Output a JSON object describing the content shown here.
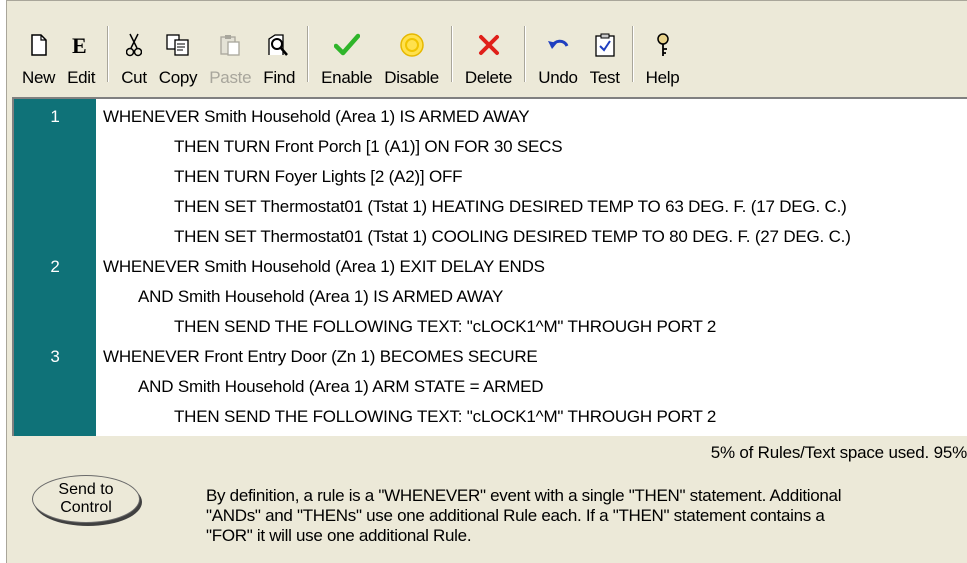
{
  "toolbar": {
    "buttons": [
      {
        "label": "New",
        "icon": "new-document-icon"
      },
      {
        "label": "Edit",
        "icon": "edit-icon"
      },
      {
        "label": "Cut",
        "icon": "scissors-icon"
      },
      {
        "label": "Copy",
        "icon": "copy-icon"
      },
      {
        "label": "Paste",
        "icon": "paste-icon",
        "disabled": true
      },
      {
        "label": "Find",
        "icon": "find-icon"
      },
      {
        "label": "Enable",
        "icon": "checkmark-icon"
      },
      {
        "label": "Disable",
        "icon": "disable-icon"
      },
      {
        "label": "Delete",
        "icon": "delete-x-icon"
      },
      {
        "label": "Undo",
        "icon": "undo-icon"
      },
      {
        "label": "Test",
        "icon": "test-icon"
      },
      {
        "label": "Help",
        "icon": "help-icon"
      }
    ]
  },
  "rules": {
    "lines": [
      {
        "num": "1",
        "text": "WHENEVER  Smith Household (Area 1) IS ARMED AWAY"
      },
      {
        "num": "",
        "text": "THEN TURN Front Porch [1 (A1)] ON FOR 30 SECS"
      },
      {
        "num": "",
        "text": "THEN TURN Foyer Lights [2 (A2)] OFF"
      },
      {
        "num": "",
        "text": "THEN SET Thermostat01 (Tstat 1) HEATING DESIRED TEMP TO 63 DEG. F. (17 DEG. C.)"
      },
      {
        "num": "",
        "text": "THEN SET Thermostat01 (Tstat 1) COOLING DESIRED TEMP TO 80 DEG. F. (27 DEG. C.)"
      },
      {
        "num": "2",
        "text": "WHENEVER  Smith Household (Area 1) EXIT DELAY ENDS"
      },
      {
        "num": "",
        "text": "AND Smith Household (Area 1) IS ARMED AWAY"
      },
      {
        "num": "",
        "text": "THEN SEND THE FOLLOWING TEXT: \"cLOCK1^M\" THROUGH PORT 2"
      },
      {
        "num": "3",
        "text": "WHENEVER Front Entry Door (Zn 1) BECOMES SECURE"
      },
      {
        "num": "",
        "text": "AND Smith Household (Area 1) ARM STATE = ARMED"
      },
      {
        "num": "",
        "text": "THEN SEND THE FOLLOWING TEXT: \"cLOCK1^M\" THROUGH PORT 2"
      }
    ]
  },
  "usage_text": "5% of Rules/Text space used.  95%",
  "send_button": {
    "line1": "Send to",
    "line2": "Control"
  },
  "note": {
    "line1": "By definition, a rule is a \"WHENEVER\" event with a single \"THEN\" statement.  Additional",
    "line2": "\"ANDs\" and \"THENs\" use one additional Rule each.  If a \"THEN\" statement contains a",
    "line3": "\"FOR\" it will use one additional Rule."
  },
  "colors": {
    "gutter": "#0f7278",
    "panel": "#ece9d8"
  }
}
